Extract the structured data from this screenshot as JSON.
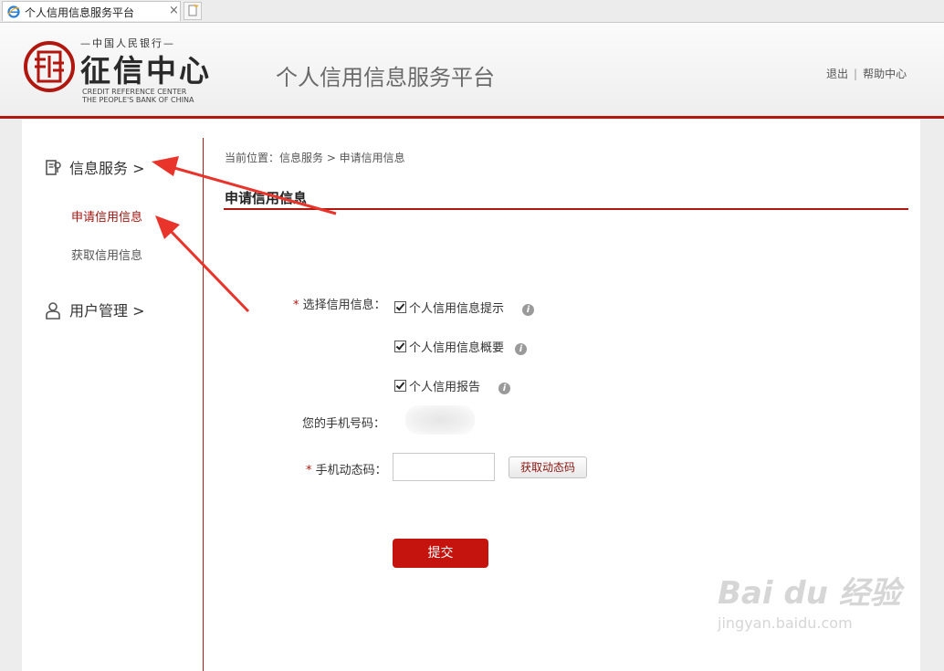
{
  "browser": {
    "tab_title": "个人信用信息服务平台",
    "tab_close": "×"
  },
  "header": {
    "logo_top": "—中国人民银行—",
    "logo_main": "征信中心",
    "logo_en_line1": "CREDIT REFERENCE CENTER",
    "logo_en_line2": "THE PEOPLE'S BANK OF CHINA",
    "platform_title": "个人信用信息服务平台",
    "logout": "退出",
    "separator": "|",
    "help": "帮助中心"
  },
  "sidebar": {
    "info_service": "信息服务 >",
    "apply_credit": "申请信用信息",
    "get_credit": "获取信用信息",
    "user_manage": "用户管理 >"
  },
  "main": {
    "breadcrumb": "当前位置：信息服务 > 申请信用信息",
    "heading": "申请信用信息",
    "select_label_star": "*",
    "select_label": "选择信用信息：",
    "options": [
      {
        "label": "个人信用信息提示",
        "checked": true
      },
      {
        "label": "个人信用信息概要",
        "checked": true
      },
      {
        "label": "个人信用报告",
        "checked": true
      }
    ],
    "info_glyph": "i",
    "phone_label": "您的手机号码：",
    "code_label_star": "*",
    "code_label": "手机动态码：",
    "code_value": "",
    "get_code_button": "获取动态码",
    "submit_button": "提交"
  },
  "colors": {
    "accent": "#b1160f",
    "submit": "#c5130d"
  },
  "watermark": {
    "text": "Bai du 经验",
    "url": "jingyan.baidu.com"
  }
}
